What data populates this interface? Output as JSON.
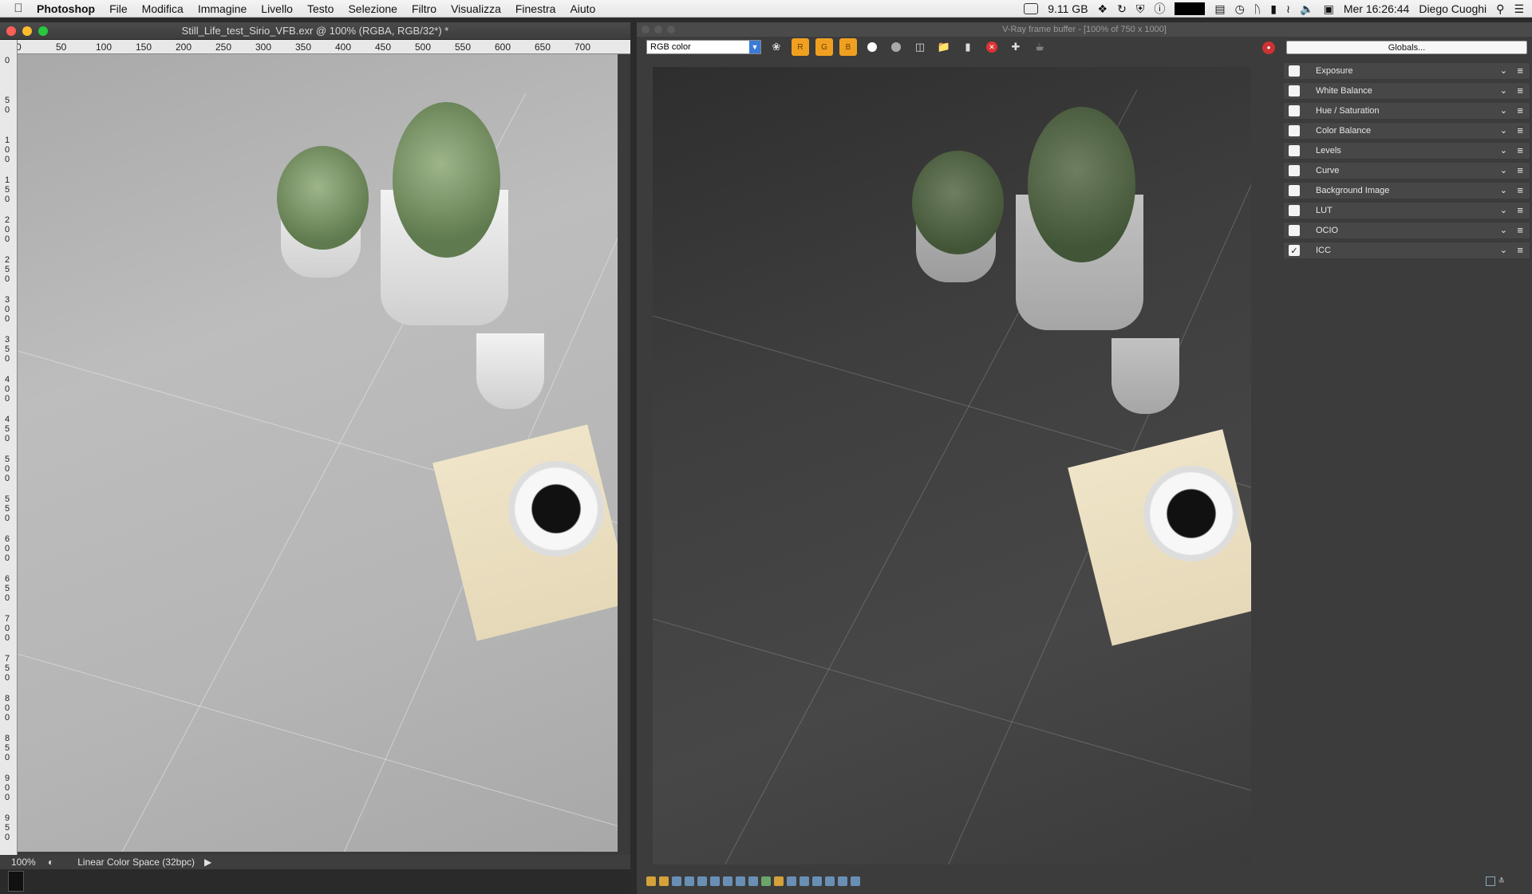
{
  "menubar": {
    "apple": "",
    "app": "Photoshop",
    "items": [
      "File",
      "Modifica",
      "Immagine",
      "Livello",
      "Testo",
      "Selezione",
      "Filtro",
      "Visualizza",
      "Finestra",
      "Aiuto"
    ],
    "memory": "9.11 GB",
    "clock": "Mer 16:26:44",
    "user": "Diego Cuoghi"
  },
  "photoshop": {
    "title": "Still_Life_test_Sirio_VFB.exr @ 100% (RGBA, RGB/32*) *",
    "ruler_top": [
      "0",
      "50",
      "100",
      "150",
      "200",
      "250",
      "300",
      "350",
      "400",
      "450",
      "500",
      "550",
      "600",
      "650",
      "700"
    ],
    "ruler_left": [
      "0",
      "50",
      "100",
      "150",
      "200",
      "250",
      "300",
      "350",
      "400",
      "450",
      "500",
      "550",
      "600",
      "650",
      "700",
      "750",
      "800",
      "850",
      "900",
      "950"
    ],
    "zoom": "100%",
    "status_info": "Linear Color Space (32bpc)"
  },
  "vray": {
    "title": "V-Ray frame buffer - [100% of 750 x 1000]",
    "channel": "RGB color",
    "globals_label": "Globals...",
    "layers": [
      {
        "label": "Exposure",
        "checked": false
      },
      {
        "label": "White Balance",
        "checked": false
      },
      {
        "label": "Hue / Saturation",
        "checked": false
      },
      {
        "label": "Color Balance",
        "checked": false
      },
      {
        "label": "Levels",
        "checked": false
      },
      {
        "label": "Curve",
        "checked": false
      },
      {
        "label": "Background Image",
        "checked": false
      },
      {
        "label": "LUT",
        "checked": false
      },
      {
        "label": "OCIO",
        "checked": false
      },
      {
        "label": "ICC",
        "checked": true
      }
    ]
  }
}
